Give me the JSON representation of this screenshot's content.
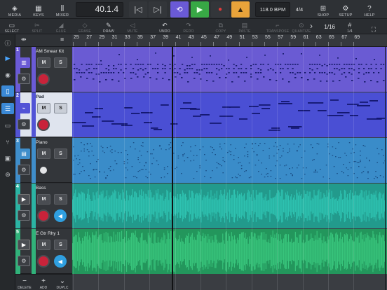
{
  "topbar": {
    "media": "MEDIA",
    "keys": "KEYS",
    "mixer": "MIXER",
    "position": "40.1.4",
    "tempo": "118.0 BPM",
    "signature": "4/4",
    "shop": "SHOP",
    "setup": "SETUP",
    "help": "HELP"
  },
  "tools": {
    "select": "SELECT",
    "split": "SPLIT",
    "glue": "GLUE",
    "erase": "ERASE",
    "draw": "DRAW",
    "mute": "MUTE",
    "undo": "UNDO",
    "redo": "REDO",
    "copy": "COPY",
    "paste": "PASTE",
    "transpose": "TRANSPOSE",
    "quantize": "QUANTIZE",
    "quantize_value": "1/16",
    "grid_value": "1/4"
  },
  "ruler": {
    "bars": [
      "25",
      "27",
      "29",
      "31",
      "33",
      "35",
      "37",
      "39",
      "41",
      "43",
      "45",
      "47",
      "49",
      "51",
      "53",
      "55",
      "57",
      "59",
      "61",
      "63",
      "65",
      "67",
      "69"
    ]
  },
  "tracks": [
    {
      "number": "1",
      "name": "AM Smear Kit",
      "type": "drum",
      "color": "#6a5ad6",
      "mute": "M",
      "solo": "S",
      "record_armed": true,
      "monitor": false
    },
    {
      "number": "2",
      "name": "Pad",
      "type": "synth",
      "color": "#5254d6",
      "mute": "M",
      "solo": "S",
      "record_armed": true,
      "monitor": false,
      "selected": true
    },
    {
      "number": "3",
      "name": "Piano",
      "type": "piano",
      "color": "#3f8ecb",
      "mute": "M",
      "solo": "S",
      "record_armed": false,
      "monitor": false
    },
    {
      "number": "4",
      "name": "Bass",
      "type": "audio",
      "color": "#2bb4a4",
      "mute": "M",
      "solo": "S",
      "record_armed": true,
      "monitor": true
    },
    {
      "number": "5",
      "name": "E Gtr Rhy 1",
      "type": "audio",
      "color": "#31b27a",
      "mute": "M",
      "solo": "S",
      "record_armed": true,
      "monitor": true
    }
  ],
  "bottom": {
    "delete": "DELETE",
    "add": "ADD",
    "duplicate": "DUPLC"
  },
  "colors": {
    "accent": "#6a5ad6",
    "play": "#38a845",
    "record": "#c9233a",
    "metronome": "#e9a33a"
  }
}
